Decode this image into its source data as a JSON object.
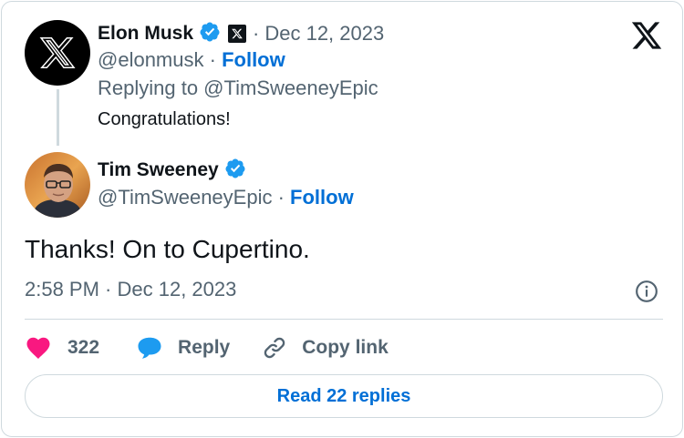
{
  "colors": {
    "verified": "#1d9bf0",
    "link": "#006fd6",
    "like": "#f91880",
    "reply_bubble": "#1d9bf0",
    "muted": "#536471",
    "border": "#cfd9de"
  },
  "icons": {
    "brand": "x-logo-icon",
    "verified": "verified-badge-icon",
    "info": "info-icon",
    "like": "heart-icon",
    "reply": "chat-bubble-icon",
    "copy": "link-icon"
  },
  "parent_tweet": {
    "author_name": "Elon Musk",
    "handle": "@elonmusk",
    "separator": "·",
    "date": "Dec 12, 2023",
    "follow_label": "Follow",
    "replying_to": "Replying to @TimSweeneyEpic",
    "text": "Congratulations!"
  },
  "main_tweet": {
    "author_name": "Tim Sweeney",
    "handle": "@TimSweeneyEpic",
    "separator": "·",
    "follow_label": "Follow",
    "text": "Thanks! On to Cupertino.",
    "timestamp": "2:58 PM · Dec 12, 2023"
  },
  "actions": {
    "like_count": "322",
    "reply_label": "Reply",
    "copy_label": "Copy link"
  },
  "read_replies_label": "Read 22 replies"
}
